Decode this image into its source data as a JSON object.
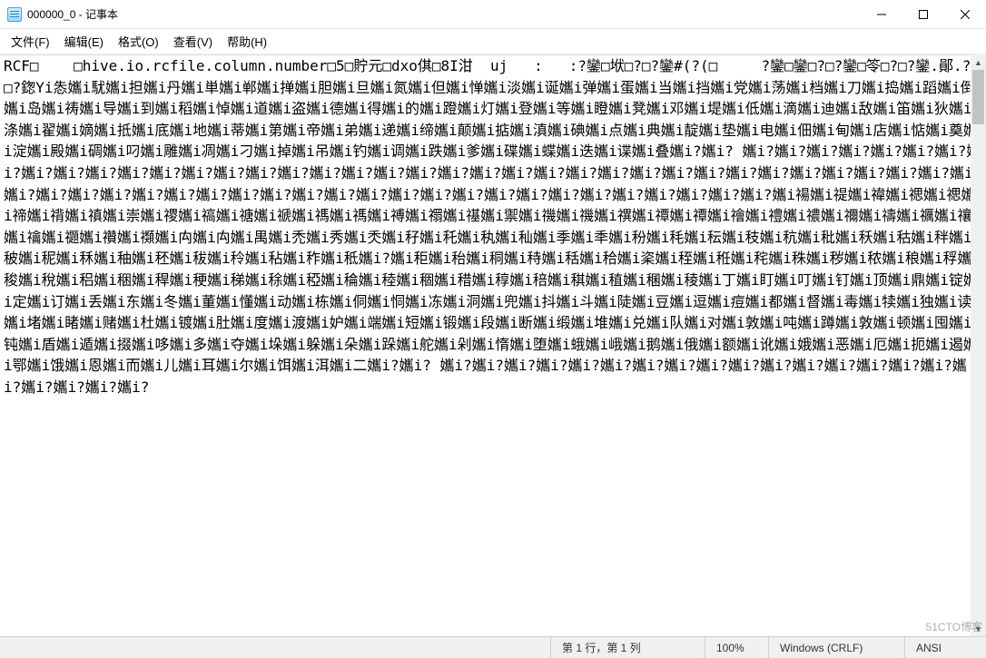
{
  "window": {
    "title": "000000_0 - 记事本"
  },
  "menu": {
    "file": "文件(F)",
    "edit": "编辑(E)",
    "format": "格式(O)",
    "view": "查看(V)",
    "help": "帮助(H)"
  },
  "content": {
    "text": "RCF□    □hive.io.rcfile.column.number□5□貯元□dxo倛□8I泔  uj   :   :?鑾□垘□?□?鑾#(?(□     ?鑾□鑾□?□?鑾□笭□?□?鑾.鄖.?□?鍯Yi怣孈i駀孈i担孈i丹孈i単孈i郸孈i掸孈i胆孈i旦孈i氮孈i但孈i惮孈i淡孈i诞孈i弹孈i蛋孈i当孈i挡孈i党孈i荡孈i档孈i刀孈i捣孈i蹈孈i倒孈i岛孈i祷孈i导孈i到孈i稻孈i悼孈i道孈i盗孈i德孈i得孈i的孈i蹬孈i灯孈i登孈i等孈i瞪孈i凳孈i邓孈i堤孈i低孈i滴孈i迪孈i敌孈i笛孈i狄孈i涤孈i翟孈i嫡孈i抵孈i底孈i地孈i蒂孈i第孈i帝孈i弟孈i递孈i缔孈i颠孈i掂孈i滇孈i碘孈i点孈i典孈i靛孈i垫孈i电孈i佃孈i甸孈i店孈i惦孈i奠孈i淀孈i殿孈i碉孈i叼孈i雕孈i凋孈i刁孈i掉孈i吊孈i钓孈i调孈i跌孈i爹孈i碟孈i蝶孈i迭孈i谍孈i叠孈i?孈i? 孈i?孈i?孈i?孈i?孈i?孈i?孈i?孈i?孈i?孈i?孈i?孈i?孈i?孈i?孈i?孈i?孈i?孈i?孈i?孈i?孈i?孈i?孈i?孈i?孈i?孈i?孈i?孈i?孈i?孈i?孈i?孈i?孈i?孈i?孈i?孈i?孈i?孈i?孈i?孈i?孈i?孈i?孈i?孈i?孈i?孈i?孈i?孈i?孈i?孈i?孈i?孈i?孈i?孈i?孈i?孈i?孈i?孈i?孈i?孈i?孈i?孈i?孈i禓孈i禔孈i禕孈i禗孈i禗孈i禘孈i禙孈i禛孈i崇孈i禝孈i禞孈i禟孈i禠孈i禡孈i禡孈i禣孈i禤孈i禥孈i禦孈i禨孈i禨孈i禩孈i禫孈i禫孈i禬孈i禮孈i禯孈i禰孈i禱孈i禲孈i禳孈i禴孈i禵孈i禶孈i禷孈i禸孈i禸孈i禺孈i禿孈i秀孈i秂孈i秄孈i秅孈i秇孈i秈孈i季孈i秊孈i秎孈i秏孈i秐孈i秓孈i秔孈i秕孈i秗孈i秙孈i秚孈i秛孈i秜孈i秝孈i秞孈i秠孈i秡孈i秢孈i秥孈i秨孈i秪孈i?孈i秬孈i秮孈i秱孈i秲孈i秳孈i秴孈i秶孈i秷孈i秹孈i秺孈i秼孈i秽孈i秾孈i稂孈i稃孈i稄孈i稅孈i稆孈i稇孈i稈孈i稉孈i稊孈i稌孈i稏孈i稐孈i稑孈i稒孈i稓孈i稕孈i稖孈i稘孈i稙孈i稛孈i稜孈i丁孈i盯孈i叮孈i钉孈i顶孈i鼎孈i锭孈i定孈i订孈i丢孈i东孈i冬孈i董孈i懂孈i动孈i栋孈i侗孈i恫孈i冻孈i洞孈i兜孈i抖孈i斗孈i陡孈i豆孈i逗孈i痘孈i都孈i督孈i毒孈i犊孈i独孈i读孈i堵孈i睹孈i赌孈i杜孈i镀孈i肚孈i度孈i渡孈i妒孈i端孈i短孈i锻孈i段孈i断孈i缎孈i堆孈i兑孈i队孈i对孈i敦孈i吨孈i蹲孈i敦孈i顿孈i囤孈i钝孈i盾孈i遁孈i掇孈i哆孈i多孈i夺孈i垛孈i躲孈i朵孈i跺孈i舵孈i剁孈i惰孈i堕孈i蛾孈i峨孈i鹅孈i俄孈i额孈i讹孈i娥孈i恶孈i厄孈i扼孈i遏孈i鄂孈i饿孈i恩孈i而孈i儿孈i耳孈i尔孈i饵孈i洱孈i二孈i?孈i? 孈i?孈i?孈i?孈i?孈i?孈i?孈i?孈i?孈i?孈i?孈i?孈i?孈i?孈i?孈i?孈i?孈i?孈i?孈i?孈i?孈i?"
  },
  "status": {
    "position": "第 1 行，第 1 列",
    "zoom": "100%",
    "eol": "Windows (CRLF)",
    "encoding": "ANSI"
  },
  "watermark": "51CTO博客"
}
